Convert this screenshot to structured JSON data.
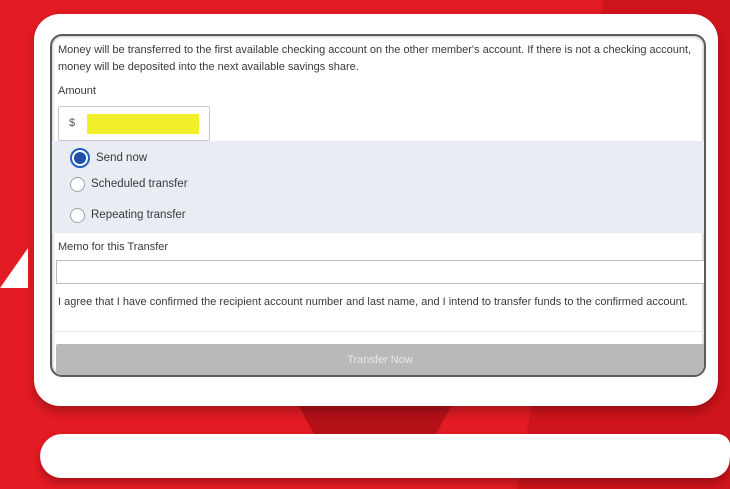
{
  "colors": {
    "background": "#e31b23",
    "accent_radio": "#1f4fa8",
    "highlight": "#f2f02a",
    "button_disabled": "#b9b9b9"
  },
  "form": {
    "info_text": "Money will be transferred to the first available checking account on the other member's account. If there is not a checking account, money will be deposited into the next available savings share.",
    "amount_label": "Amount",
    "currency_symbol": "$",
    "amount_value": "",
    "timing_options": [
      {
        "label": "Send now",
        "selected": true
      },
      {
        "label": "Scheduled transfer",
        "selected": false
      },
      {
        "label": "Repeating transfer",
        "selected": false
      }
    ],
    "memo_label": "Memo for this Transfer",
    "memo_value": "",
    "agreement_text": "I agree that I have confirmed the recipient account number and last name, and I intend to transfer funds to the confirmed account.",
    "submit_label": "Transfer Now"
  }
}
